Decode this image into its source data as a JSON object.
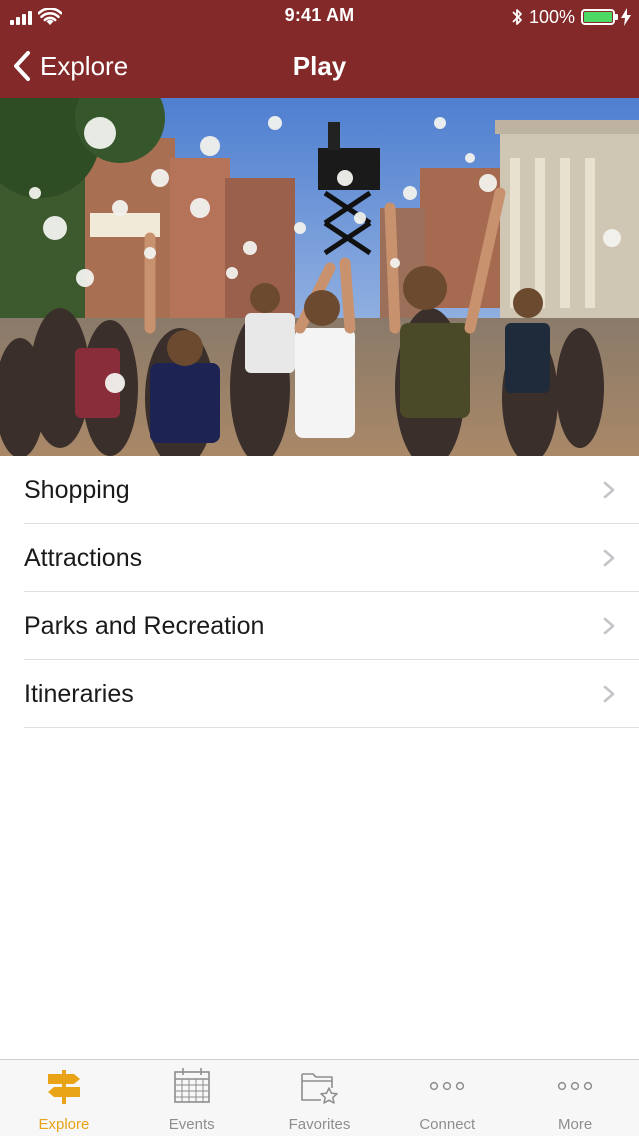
{
  "status_bar": {
    "time": "9:41 AM",
    "battery_percent": "100%"
  },
  "nav": {
    "back_label": "Explore",
    "title": "Play"
  },
  "hero": {
    "icon": "hero-photo-parade-crowd"
  },
  "menu": {
    "items": [
      {
        "label": "Shopping"
      },
      {
        "label": "Attractions"
      },
      {
        "label": "Parks and Recreation"
      },
      {
        "label": "Itineraries"
      }
    ]
  },
  "tab_bar": {
    "tabs": [
      {
        "label": "Explore",
        "icon": "signpost-icon",
        "active": true
      },
      {
        "label": "Events",
        "icon": "calendar-icon",
        "active": false
      },
      {
        "label": "Favorites",
        "icon": "folder-star-icon",
        "active": false
      },
      {
        "label": "Connect",
        "icon": "ellipsis-icon",
        "active": false
      },
      {
        "label": "More",
        "icon": "ellipsis-icon",
        "active": false
      }
    ]
  },
  "colors": {
    "header_bg": "#84292a",
    "accent": "#e8a317",
    "inactive_tab": "#8e8e8e",
    "battery_fill": "#4cd964"
  }
}
